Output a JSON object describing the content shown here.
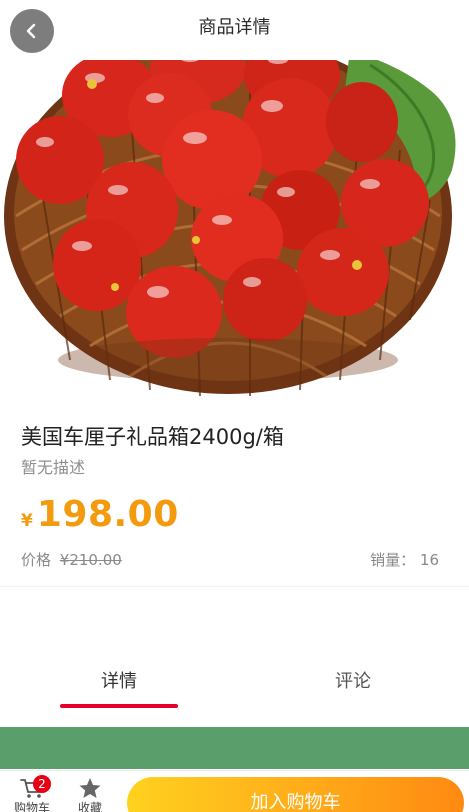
{
  "header": {
    "title": "商品详情",
    "back_icon": "chevron-left-icon"
  },
  "product": {
    "image_icon": "tomato-basket-image",
    "name": "美国车厘子礼品箱2400g/箱",
    "description": "暂无描述",
    "currency": "¥",
    "price": "198.00",
    "original_price_label": "价格",
    "original_price": "¥210.00",
    "sales_label": "销量：",
    "sales_count": "16"
  },
  "tabs": [
    {
      "label": "详情",
      "active": true
    },
    {
      "label": "评论",
      "active": false
    }
  ],
  "bottom_bar": {
    "cart_label": "购物车",
    "cart_badge": "2",
    "cart_icon": "cart-icon",
    "favorite_label": "收藏",
    "favorite_icon": "star-icon",
    "add_to_cart_label": "加入购物车"
  },
  "colors": {
    "accent": "#f39a0e",
    "tab_underline": "#e4002b",
    "badge": "#e60012",
    "green_band": "#5a9e6c",
    "button_start": "#ffd21f",
    "button_end": "#ff8a12"
  }
}
